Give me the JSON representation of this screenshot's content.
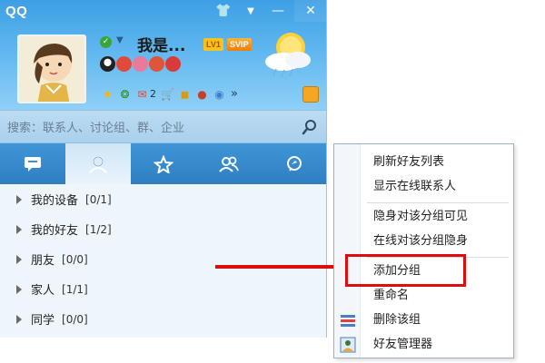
{
  "window": {
    "app_title": "QQ",
    "buttons": {
      "skin": "👕",
      "menu": "▼",
      "minimize": "—",
      "close": "✕"
    }
  },
  "profile": {
    "nickname": "我是...",
    "status": "online",
    "level_badge": "LV1",
    "svip_badge": "SVIP"
  },
  "toolbar": {
    "mail_count": "2",
    "more": "»"
  },
  "search": {
    "placeholder": "搜索：联系人、讨论组、群、企业"
  },
  "tabs": [
    {
      "name": "recent-chats",
      "icon": "chat-bubble-icon"
    },
    {
      "name": "contacts",
      "icon": "person-icon",
      "active": true
    },
    {
      "name": "favorites",
      "icon": "star-icon"
    },
    {
      "name": "groups",
      "icon": "group-icon"
    },
    {
      "name": "discover",
      "icon": "compass-icon"
    }
  ],
  "groups": [
    {
      "label": "我的设备",
      "count": "[0/1]"
    },
    {
      "label": "我的好友",
      "count": "[1/2]"
    },
    {
      "label": "朋友",
      "count": "[0/0]"
    },
    {
      "label": "家人",
      "count": "[1/1]"
    },
    {
      "label": "同学",
      "count": "[0/0]"
    }
  ],
  "context_menu": {
    "items": [
      {
        "label": "刷新好友列表"
      },
      {
        "label": "显示在线联系人"
      },
      {
        "label": "隐身对该分组可见"
      },
      {
        "label": "在线对该分组隐身"
      },
      {
        "label": "添加分组",
        "highlighted": true
      },
      {
        "label": "重命名"
      },
      {
        "label": "删除该组",
        "icon": "delete-group-icon"
      },
      {
        "label": "好友管理器",
        "icon": "friend-manager-icon"
      }
    ]
  },
  "colors": {
    "header_top": "#3d9fe4",
    "tab_bar": "#2f7fc2",
    "highlight_red": "#dd0d0d"
  }
}
